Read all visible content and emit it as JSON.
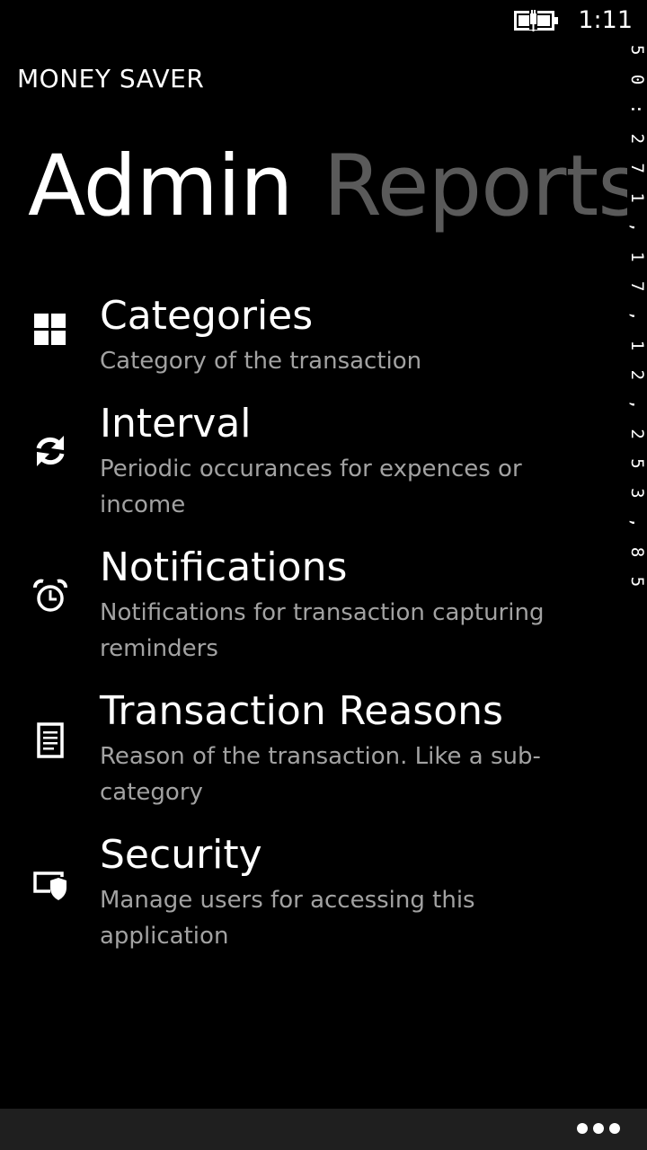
{
  "status_bar": {
    "time": "1:11",
    "battery_icon": "battery-charging-icon"
  },
  "app": {
    "title": "MONEY SAVER"
  },
  "pivot": {
    "items": [
      {
        "label": "Admin",
        "active": true
      },
      {
        "label": "Reports",
        "active": false
      }
    ]
  },
  "debug_overlay": {
    "text": "5 0 : 2 7 1 , 1 7 , 1 2 , 2 5 3 , 8 5 5"
  },
  "menu": {
    "items": [
      {
        "icon": "categories-grid-icon",
        "title": "Categories",
        "description": "Category of the transaction"
      },
      {
        "icon": "sync-icon",
        "title": "Interval",
        "description": "Periodic occurances for expences or income"
      },
      {
        "icon": "alarm-clock-icon",
        "title": "Notifications",
        "description": "Notifications for transaction capturing reminders"
      },
      {
        "icon": "document-icon",
        "title": "Transaction Reasons",
        "description": "Reason of the transaction. Like a sub-category"
      },
      {
        "icon": "shield-icon",
        "title": "Security",
        "description": "Manage users for accessing this application"
      }
    ]
  },
  "app_bar": {
    "more_icon": "more-ellipsis-icon"
  }
}
